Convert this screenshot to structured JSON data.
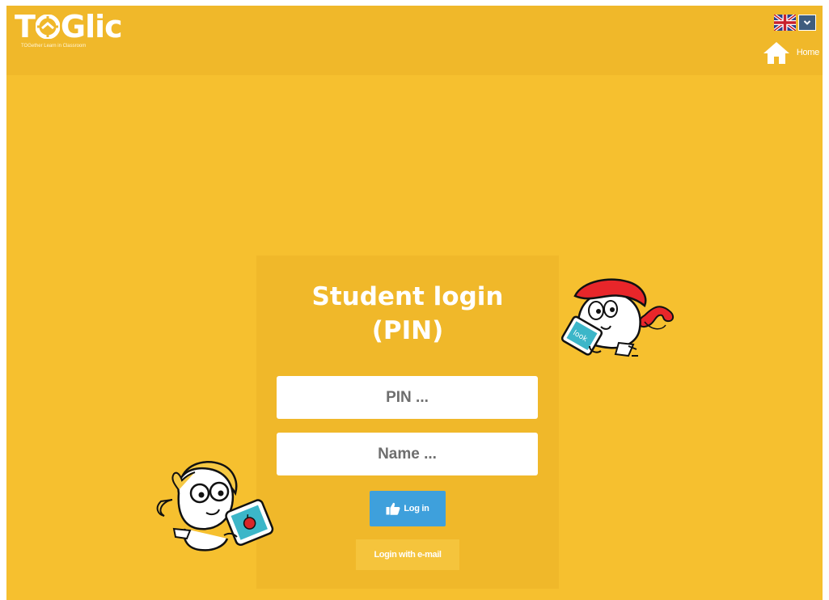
{
  "brand": {
    "name": "TOGlic",
    "name_left": "T",
    "name_right": "Glic",
    "tagline": "TOGether Learn in Classroom"
  },
  "language": {
    "selected_flag": "uk-flag-icon"
  },
  "nav": {
    "home_label": "Home"
  },
  "login": {
    "title_line1": "Student login",
    "title_line2": "(PIN)",
    "pin_placeholder": "PIN ...",
    "name_placeholder": "Name ...",
    "login_button": "Log in",
    "email_button": "Login with e-mail"
  },
  "illustrations": {
    "right_tablet_text": "look"
  },
  "colors": {
    "background": "#f6c02f",
    "header": "#f0b82a",
    "panel": "#f0b82a",
    "button_blue": "#3ea0dc",
    "language_button": "#3f5d7e"
  }
}
